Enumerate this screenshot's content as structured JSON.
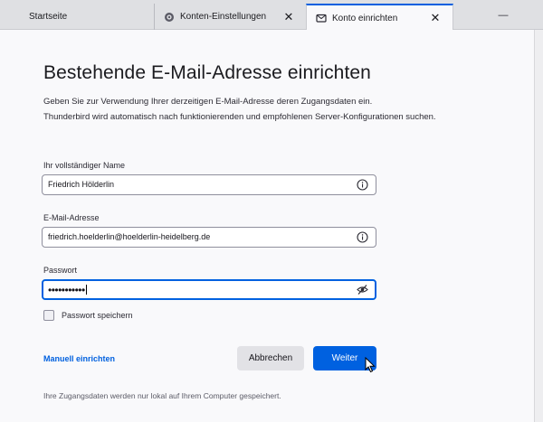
{
  "tabs": [
    {
      "label": "Startseite",
      "icon": "home",
      "closable": false
    },
    {
      "label": "Konten-Einstellungen",
      "icon": "gear-icon",
      "closable": true,
      "close_glyph": "✕"
    },
    {
      "label": "Konto einrichten",
      "icon": "account-setup-icon",
      "closable": true,
      "close_glyph": "✕",
      "active": true
    }
  ],
  "window_controls": {
    "minimize": "—"
  },
  "page": {
    "title": "Bestehende E-Mail-Adresse einrichten",
    "description_line1": "Geben Sie zur Verwendung Ihrer derzeitigen E-Mail-Adresse deren Zugangsdaten ein.",
    "description_line2": "Thunderbird wird automatisch nach funktionierenden und empfohlenen Server-Konfigurationen suchen."
  },
  "fields": {
    "name": {
      "label": "Ihr vollständiger Name",
      "value": "Friedrich Hölderlin"
    },
    "email": {
      "label": "E-Mail-Adresse",
      "value": "friedrich.hoelderlin@hoelderlin-heidelberg.de"
    },
    "password": {
      "label": "Passwort",
      "value": "•••••••••••"
    }
  },
  "remember_password": {
    "label": "Passwort speichern",
    "checked": false
  },
  "actions": {
    "manual_label": "Manuell einrichten",
    "cancel_label": "Abbrechen",
    "next_label": "Weiter"
  },
  "footer": {
    "text": "Ihre Zugangsdaten werden nur lokal auf Ihrem Computer gespeichert."
  },
  "colors": {
    "accent": "#0061e0",
    "link": "#0060df",
    "focus_border": "#0061e0"
  }
}
